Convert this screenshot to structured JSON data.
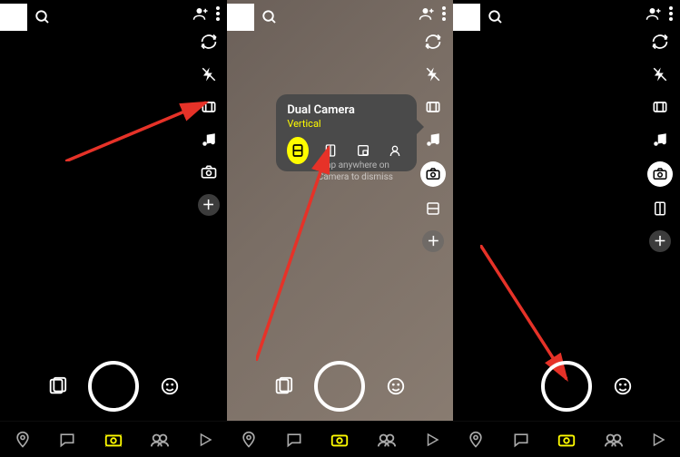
{
  "popover": {
    "title": "Dual Camera",
    "subtitle": "Vertical",
    "dismiss": "Tap anywhere on\nCamera to dismiss"
  },
  "icons": {
    "search": "search-icon",
    "add_friend": "add-friend-icon",
    "menu": "menu-icon",
    "flip": "flip-camera-icon",
    "flash": "flash-icon",
    "video": "video-icon",
    "music": "music-icon",
    "dual": "dual-camera-icon",
    "layout": "layout-icon",
    "plus": "plus-icon",
    "memories": "memories-icon",
    "smiley": "smiley-icon",
    "map": "map-pin-icon",
    "chat": "chat-icon",
    "camera": "camera-tab-icon",
    "stories": "stories-icon",
    "play": "play-icon"
  },
  "popover_options": {
    "vertical": "vertical-layout-icon",
    "horizontal": "horizontal-layout-icon",
    "pip": "picture-in-picture-icon",
    "cutout": "cutout-icon"
  }
}
